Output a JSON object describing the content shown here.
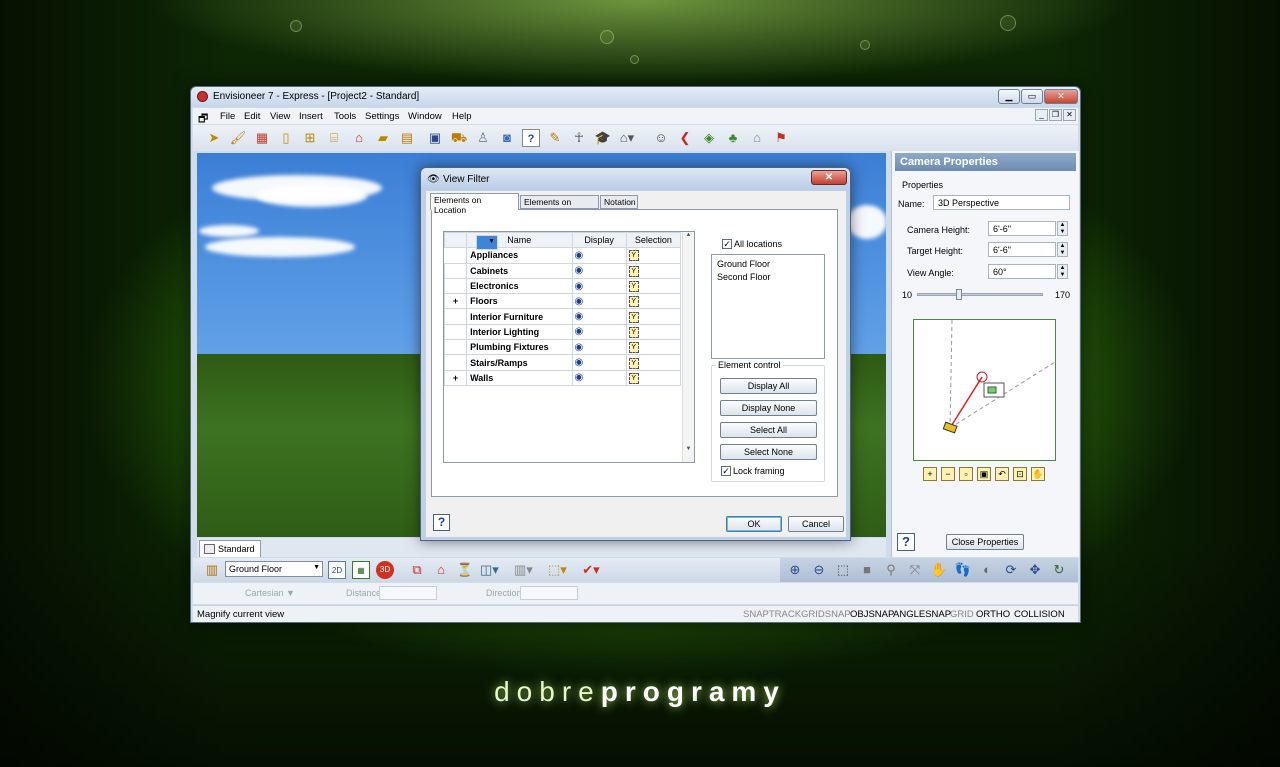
{
  "app": {
    "title": "Envisioneer 7 - Express - [Project2 - Standard]",
    "menu": [
      "File",
      "Edit",
      "View",
      "Insert",
      "Tools",
      "Settings",
      "Window",
      "Help"
    ]
  },
  "toolbar_icons": [
    "select-arrow-icon",
    "paint-brush-icon",
    "wall-icon",
    "door-icon",
    "window-icon",
    "stairs-icon",
    "roof-icon",
    "floor-icon",
    "cabinet-icon",
    "screen-icon",
    "sofa-icon",
    "lamp-icon",
    "camera-icon",
    "help-icon",
    "paint-icon",
    "figure-icon",
    "grad-cap-icon",
    "home-dropdown-icon",
    "person-icon",
    "arrow-left-icon",
    "terrain-icon",
    "plant-icon",
    "house-outline-icon",
    "house-flag-icon"
  ],
  "view_tab": "Standard",
  "bottom": {
    "floor_select": "Ground Floor",
    "btn_2d": "2D",
    "btn_3d": "3D"
  },
  "coords": {
    "mode": "Cartesian ▼",
    "distance_label": "Distance",
    "direction_label": "Direction"
  },
  "status": {
    "text": "Magnify current view",
    "snaps": [
      "SNAPTRACK",
      "GRIDSNAP",
      "OBJSNAP",
      "ANGLESNAP",
      "GRID",
      "ORTHO",
      "COLLISION"
    ],
    "active": [
      "OBJSNAP",
      "ANGLESNAP",
      "ORTHO",
      "COLLISION"
    ]
  },
  "camera": {
    "title": "Camera Properties",
    "section": "Properties",
    "name_label": "Name:",
    "name_value": "3D Perspective",
    "height_label": "Camera Height:",
    "height_value": "6'-6\"",
    "target_label": "Target Height:",
    "target_value": "6'-6\"",
    "angle_label": "View Angle:",
    "angle_value": "60°",
    "slider_min": "10",
    "slider_max": "170",
    "slider_value": 60,
    "close_btn": "Close Properties"
  },
  "dialog": {
    "title": "View Filter",
    "tabs": [
      "Elements on Location",
      "Elements on Terrain",
      "Notation"
    ],
    "columns": [
      "Name",
      "Display",
      "Selection"
    ],
    "rows": [
      {
        "expand": "",
        "name": "Appliances"
      },
      {
        "expand": "",
        "name": "Cabinets"
      },
      {
        "expand": "",
        "name": "Electronics"
      },
      {
        "expand": "+",
        "name": "Floors"
      },
      {
        "expand": "",
        "name": "Interior Furniture"
      },
      {
        "expand": "",
        "name": "Interior Lighting"
      },
      {
        "expand": "",
        "name": "Plumbing Fixtures"
      },
      {
        "expand": "",
        "name": "Stairs/Ramps"
      },
      {
        "expand": "+",
        "name": "Walls"
      }
    ],
    "all_locations": "All locations",
    "locations": [
      "Ground Floor",
      "Second Floor"
    ],
    "element_control": "Element control",
    "display_all": "Display All",
    "display_none": "Display None",
    "select_all": "Select All",
    "select_none": "Select None",
    "lock_framing": "Lock framing",
    "ok": "OK",
    "cancel": "Cancel"
  },
  "watermark": {
    "light": "dobre",
    "bold": "programy"
  },
  "colors": {
    "accent": "#3b86d9",
    "panel_header": "#7a97bd",
    "grass": "#3d7320",
    "sky": "#3b7fd6"
  }
}
